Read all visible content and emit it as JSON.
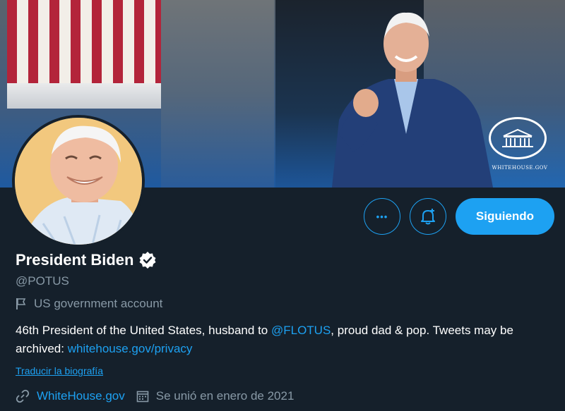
{
  "banner": {
    "caption": "WHITEHOUSE.GOV"
  },
  "actions": {
    "more_label": "•••",
    "follow_label": "Siguiendo"
  },
  "profile": {
    "name": "President Biden",
    "handle": "@POTUS",
    "account_label": "US government account",
    "bio": {
      "part1": "46th President of the United States, husband to ",
      "mention": "@FLOTUS",
      "part2": ", proud dad & pop. Tweets may be archived: ",
      "link": "whitehouse.gov/privacy"
    },
    "translate_label": "Traducir la biografía",
    "website": "WhiteHouse.gov",
    "joined": "Se unió en enero de 2021"
  },
  "colors": {
    "background": "#15202b",
    "accent": "#1da1f2",
    "secondary_text": "#8899a6"
  },
  "icons": [
    "flag-icon",
    "verified-badge-icon",
    "more-icon",
    "bell-plus-icon",
    "link-icon",
    "calendar-icon",
    "white-house-logo-icon"
  ]
}
